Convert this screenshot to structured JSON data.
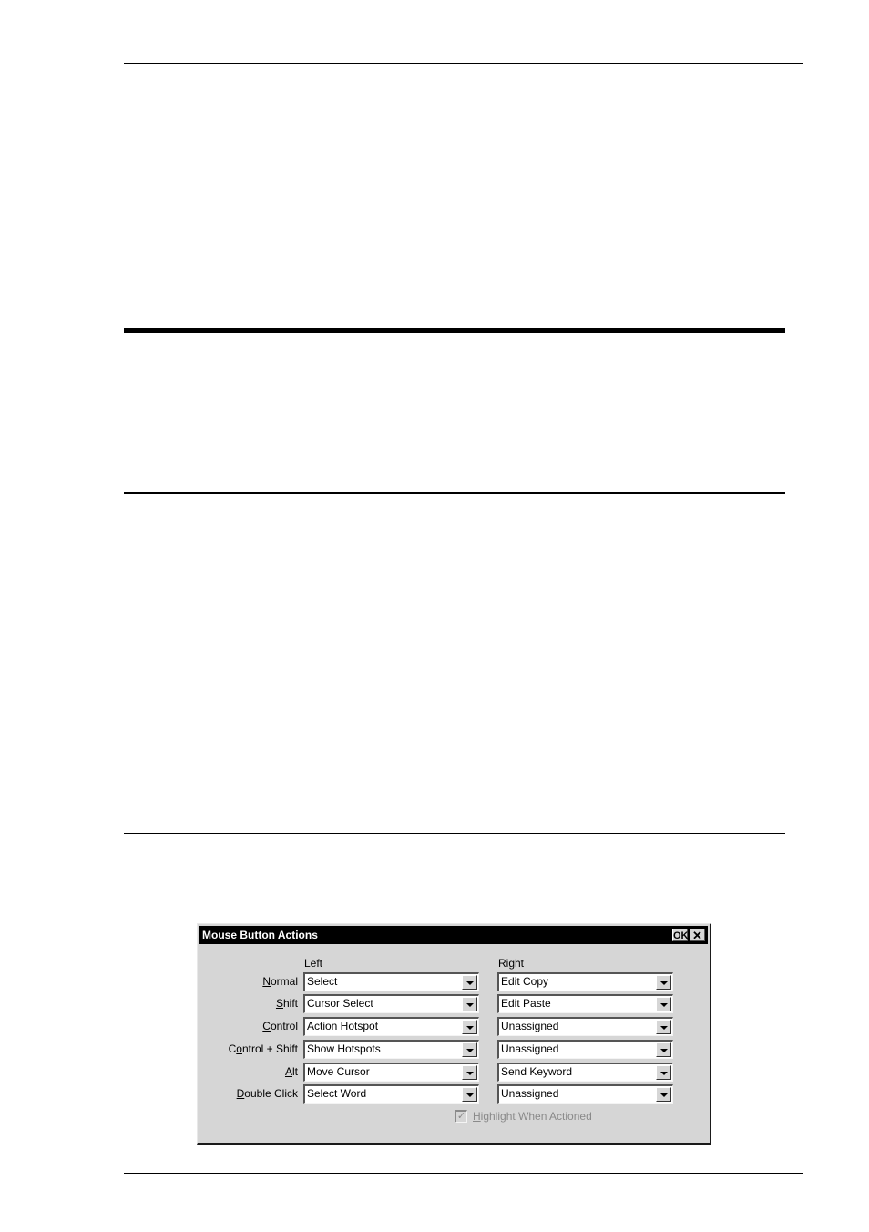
{
  "dialog": {
    "title": "Mouse Button Actions",
    "ok_label": "OK",
    "close_label": "✕",
    "columns": {
      "left": "Left",
      "right": "Right"
    },
    "rows": [
      {
        "label_pre": "",
        "label_ul": "N",
        "label_post": "ormal",
        "left": "Select",
        "right": "Edit Copy"
      },
      {
        "label_pre": "",
        "label_ul": "S",
        "label_post": "hift",
        "left": "Cursor Select",
        "right": "Edit Paste"
      },
      {
        "label_pre": "",
        "label_ul": "C",
        "label_post": "ontrol",
        "left": "Action Hotspot",
        "right": "Unassigned"
      },
      {
        "label_pre": "C",
        "label_ul": "o",
        "label_post": "ntrol + Shift",
        "left": "Show Hotspots",
        "right": "Unassigned"
      },
      {
        "label_pre": "",
        "label_ul": "A",
        "label_post": "lt",
        "left": "Move Cursor",
        "right": "Send Keyword"
      },
      {
        "label_pre": "",
        "label_ul": "D",
        "label_post": "ouble Click",
        "left": "Select Word",
        "right": "Unassigned"
      }
    ],
    "highlight": {
      "label_ul": "H",
      "label_post": "ighlight When Actioned",
      "checked": true,
      "enabled": false,
      "check_glyph": "✓"
    }
  }
}
